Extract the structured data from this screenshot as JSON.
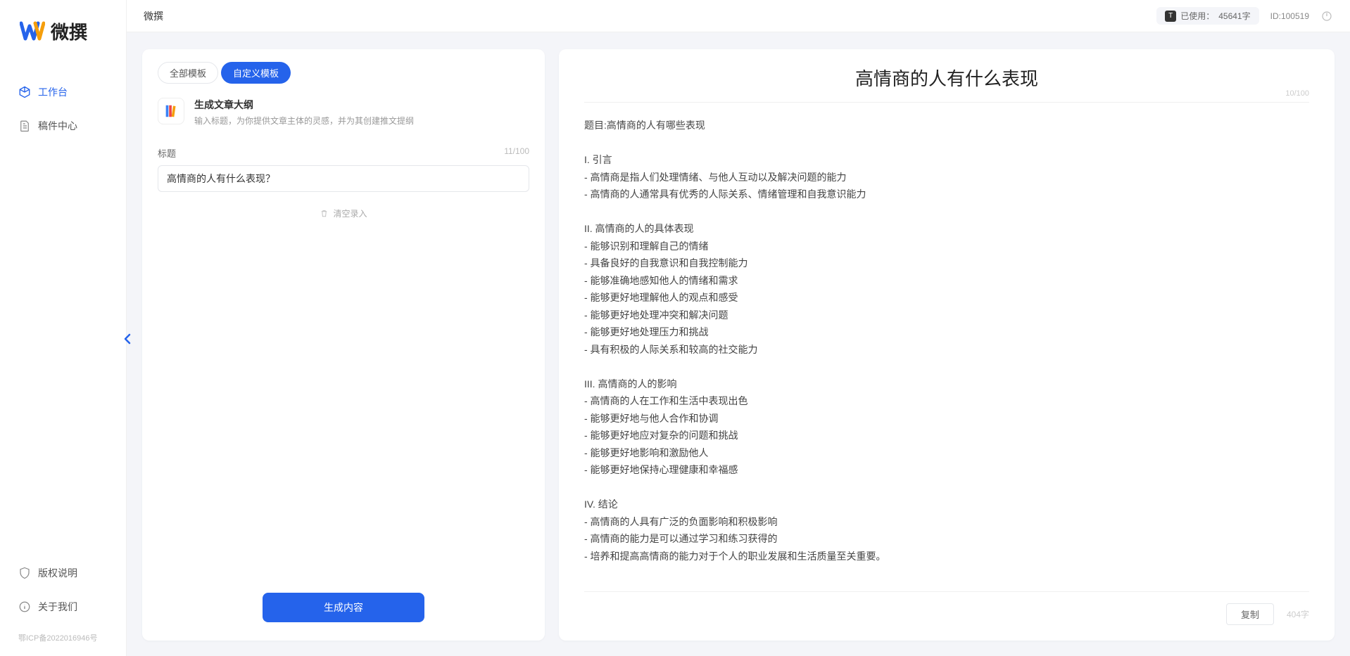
{
  "brand": {
    "name": "微撰"
  },
  "sidebar": {
    "nav": [
      {
        "label": "工作台",
        "active": true
      },
      {
        "label": "稿件中心",
        "active": false
      }
    ],
    "bottom": [
      {
        "label": "版权说明"
      },
      {
        "label": "关于我们"
      }
    ],
    "icp": "鄂ICP备2022016946号"
  },
  "topbar": {
    "title": "微撰",
    "usage_prefix": "已使用：",
    "usage_value": "45641字",
    "user_id": "ID:100519"
  },
  "left": {
    "tabs": {
      "all": "全部模板",
      "custom": "自定义模板"
    },
    "template": {
      "title": "生成文章大纲",
      "desc": "输入标题，为你提供文章主体的灵感，并为其创建推文提纲"
    },
    "field_label": "标题",
    "char_count": "11/100",
    "input_value": "高情商的人有什么表现？",
    "clear_label": "清空录入",
    "generate_label": "生成内容"
  },
  "right": {
    "title": "高情商的人有什么表现",
    "meta": "10/100",
    "body": "题目:高情商的人有哪些表现\n\nI. 引言\n- 高情商是指人们处理情绪、与他人互动以及解决问题的能力\n- 高情商的人通常具有优秀的人际关系、情绪管理和自我意识能力\n\nII. 高情商的人的具体表现\n- 能够识别和理解自己的情绪\n- 具备良好的自我意识和自我控制能力\n- 能够准确地感知他人的情绪和需求\n- 能够更好地理解他人的观点和感受\n- 能够更好地处理冲突和解决问题\n- 能够更好地处理压力和挑战\n- 具有积极的人际关系和较高的社交能力\n\nIII. 高情商的人的影响\n- 高情商的人在工作和生活中表现出色\n- 能够更好地与他人合作和协调\n- 能够更好地应对复杂的问题和挑战\n- 能够更好地影响和激励他人\n- 能够更好地保持心理健康和幸福感\n\nIV. 结论\n- 高情商的人具有广泛的负面影响和积极影响\n- 高情商的能力是可以通过学习和练习获得的\n- 培养和提高高情商的能力对于个人的职业发展和生活质量至关重要。",
    "copy_label": "复制",
    "word_count": "404字"
  }
}
